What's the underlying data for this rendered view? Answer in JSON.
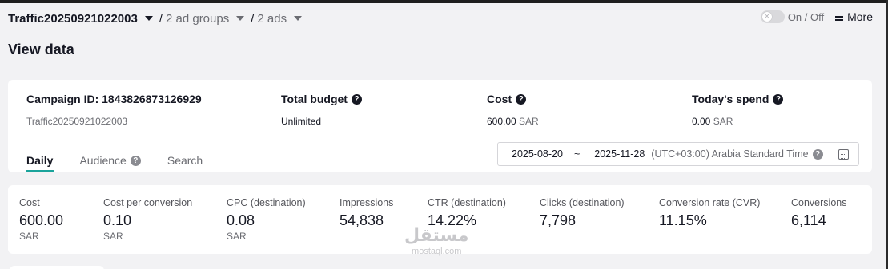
{
  "header": {
    "campaign": "Traffic20250921022003",
    "separator": "/",
    "ad_groups": "2 ad groups",
    "ads": "2 ads",
    "toggle_label": "On / Off",
    "more_label": "More"
  },
  "page": {
    "title": "View data"
  },
  "summary": {
    "campaign_id_label": "Campaign ID: 1843826873126929",
    "campaign_name": "Traffic20250921022003",
    "budget_label": "Total budget",
    "budget_value": "Unlimited",
    "cost_label": "Cost",
    "cost_value": "600.00",
    "cost_unit": "SAR",
    "spend_label": "Today's spend",
    "spend_value": "0.00",
    "spend_unit": "SAR"
  },
  "tabs": [
    {
      "label": "Daily",
      "active": true
    },
    {
      "label": "Audience",
      "active": false
    },
    {
      "label": "Search",
      "active": false
    }
  ],
  "date_range": {
    "start": "2025-08-20",
    "sep": "~",
    "end": "2025-11-28",
    "timezone": "(UTC+03:00) Arabia Standard Time"
  },
  "metrics": [
    {
      "label": "Cost",
      "value": "600.00",
      "unit": "SAR"
    },
    {
      "label": "Cost per conversion",
      "value": "0.10",
      "unit": "SAR"
    },
    {
      "label": "CPC (destination)",
      "value": "0.08",
      "unit": "SAR"
    },
    {
      "label": "Impressions",
      "value": "54,838",
      "unit": ""
    },
    {
      "label": "CTR (destination)",
      "value": "14.22%",
      "unit": ""
    },
    {
      "label": "Clicks (destination)",
      "value": "7,798",
      "unit": ""
    },
    {
      "label": "Conversion rate (CVR)",
      "value": "11.15%",
      "unit": ""
    },
    {
      "label": "Conversions",
      "value": "6,114",
      "unit": ""
    }
  ],
  "watermark": {
    "main": "مستقل",
    "sub": "mostaql.com"
  },
  "colors": {
    "accent": "#1aa39b",
    "text": "#161823",
    "muted": "#6b6c72",
    "background": "#f2f2f4"
  }
}
